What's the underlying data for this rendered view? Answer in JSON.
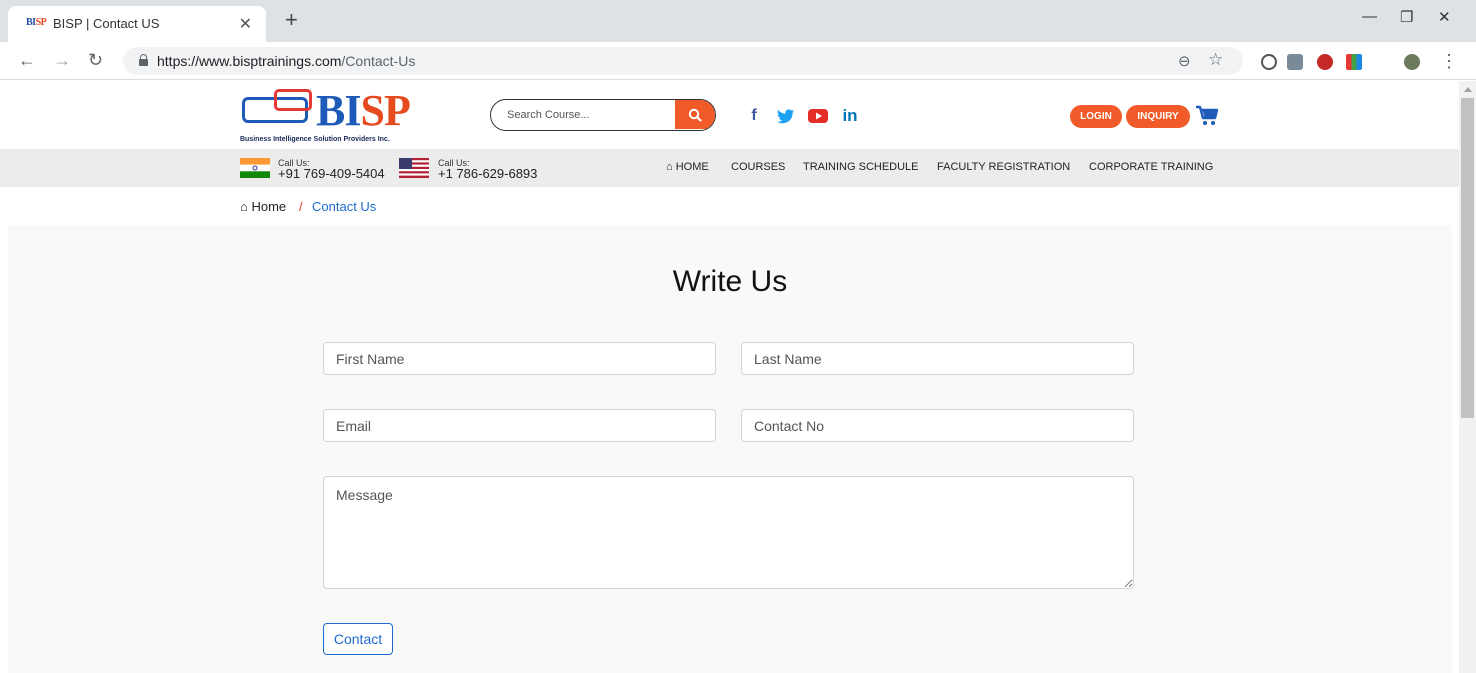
{
  "browser": {
    "tab_title": "BISP | Contact US",
    "favicon_text_a": "BI",
    "favicon_text_b": "SP",
    "url_host": "https://www.bisptrainings.com",
    "url_path": "/Contact-Us"
  },
  "header": {
    "logo_b": "BI",
    "logo_sp": "SP",
    "logo_tagline": "Business Intelligence Solution Providers Inc.",
    "search_placeholder": "Search Course...",
    "login_label": "LOGIN",
    "inquiry_label": "INQUIRY"
  },
  "contacts": [
    {
      "label": "Call Us:",
      "number": "+91 769-409-5404"
    },
    {
      "label": "Call Us:",
      "number": "+1 786-629-6893"
    }
  ],
  "nav": {
    "home": "HOME",
    "courses": "COURSES",
    "training_schedule": "TRAINING SCHEDULE",
    "faculty_registration": "FACULTY REGISTRATION",
    "corporate_training": "CORPORATE TRAINING"
  },
  "breadcrumb": {
    "home": "Home",
    "separator": "/",
    "current": "Contact Us"
  },
  "form": {
    "heading": "Write Us",
    "first_name_placeholder": "First Name",
    "last_name_placeholder": "Last Name",
    "email_placeholder": "Email",
    "contact_placeholder": "Contact No",
    "message_placeholder": "Message",
    "submit_label": "Contact"
  },
  "colors": {
    "brand_orange": "#f05b29",
    "brand_blue": "#1e5bb8",
    "link_blue": "#1e6bd0"
  }
}
